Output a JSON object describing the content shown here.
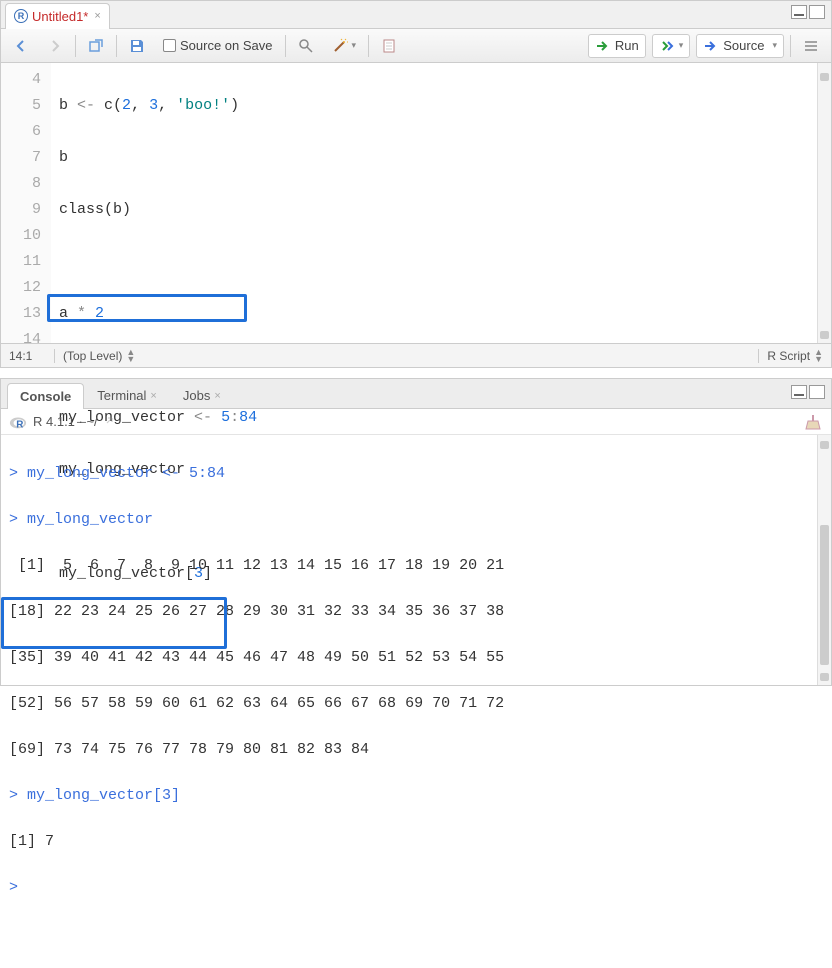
{
  "editor": {
    "tab_name": "Untitled1*",
    "toolbar": {
      "source_on_save": "Source on Save",
      "run": "Run",
      "source": "Source"
    },
    "gutter": [
      "4",
      "5",
      "6",
      "7",
      "8",
      "9",
      "10",
      "11",
      "12",
      "13",
      "14"
    ],
    "lines": {
      "l4": [
        "b ",
        "<-",
        " c(",
        "2",
        ", ",
        "3",
        ", ",
        "'boo!'",
        ")"
      ],
      "l5": "b",
      "l6": "class(b)",
      "l7": "",
      "l8": [
        "a ",
        "*",
        " ",
        "2"
      ],
      "l9": "",
      "l10": [
        "my_long_vector ",
        "<-",
        " ",
        "5",
        ":",
        "84"
      ],
      "l11": "my_long_vector",
      "l12": "",
      "l13": [
        "my_long_vector[",
        "3",
        "]"
      ],
      "l14": ""
    },
    "status": {
      "pos": "14:1",
      "scope": "(Top Level)",
      "filetype": "R Script"
    }
  },
  "console": {
    "tabs": {
      "console": "Console",
      "terminal": "Terminal",
      "jobs": "Jobs"
    },
    "header": "R 4.1.1 · ~/",
    "lines": [
      {
        "t": "in",
        "text": "my_long_vector <- 5:84"
      },
      {
        "t": "in",
        "text": "my_long_vector"
      },
      {
        "t": "out",
        "text": " [1]  5  6  7  8  9 10 11 12 13 14 15 16 17 18 19 20 21"
      },
      {
        "t": "out",
        "text": "[18] 22 23 24 25 26 27 28 29 30 31 32 33 34 35 36 37 38"
      },
      {
        "t": "out",
        "text": "[35] 39 40 41 42 43 44 45 46 47 48 49 50 51 52 53 54 55"
      },
      {
        "t": "out",
        "text": "[52] 56 57 58 59 60 61 62 63 64 65 66 67 68 69 70 71 72"
      },
      {
        "t": "out",
        "text": "[69] 73 74 75 76 77 78 79 80 81 82 83 84"
      },
      {
        "t": "in",
        "text": "my_long_vector[3]"
      },
      {
        "t": "out",
        "text": "[1] 7"
      },
      {
        "t": "prompt",
        "text": ""
      }
    ]
  }
}
